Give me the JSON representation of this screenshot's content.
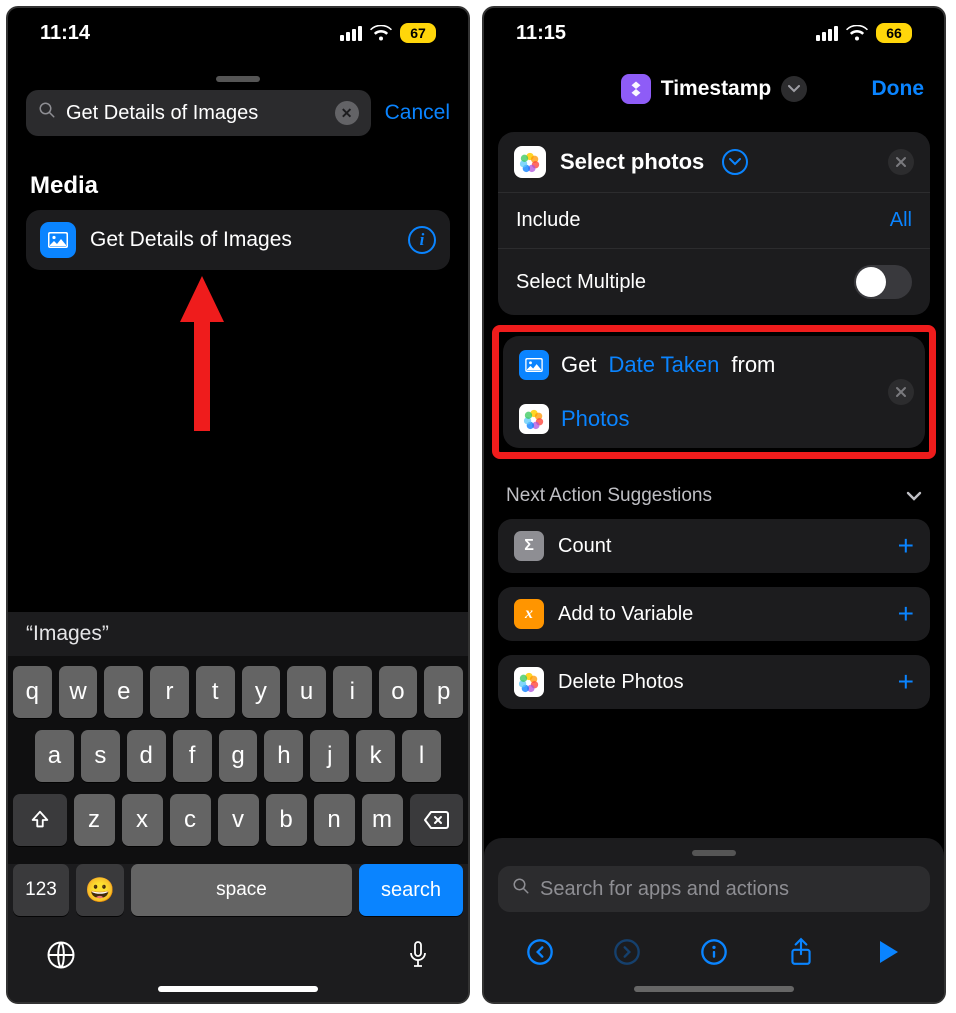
{
  "left": {
    "status": {
      "time": "11:14",
      "battery": "67"
    },
    "search": {
      "query": "Get Details of Images",
      "cancel": "Cancel"
    },
    "section_header": "Media",
    "result": {
      "label": "Get Details of Images"
    },
    "keyboard": {
      "suggestion": "“Images”",
      "row1": [
        "q",
        "w",
        "e",
        "r",
        "t",
        "y",
        "u",
        "i",
        "o",
        "p"
      ],
      "row2": [
        "a",
        "s",
        "d",
        "f",
        "g",
        "h",
        "j",
        "k",
        "l"
      ],
      "row3": [
        "z",
        "x",
        "c",
        "v",
        "b",
        "n",
        "m"
      ],
      "key123": "123",
      "space": "space",
      "search": "search"
    }
  },
  "right": {
    "status": {
      "time": "11:15",
      "battery": "66"
    },
    "header": {
      "title": "Timestamp",
      "done": "Done"
    },
    "select_card": {
      "title": "Select photos",
      "rows": {
        "include_label": "Include",
        "include_value": "All",
        "multiple_label": "Select Multiple"
      }
    },
    "get_card": {
      "prefix": "Get",
      "token1": "Date Taken",
      "mid": "from",
      "token2": "Photos"
    },
    "suggestions": {
      "header": "Next Action Suggestions",
      "items": [
        {
          "label": "Count"
        },
        {
          "label": "Add to Variable"
        },
        {
          "label": "Delete Photos"
        }
      ]
    },
    "search_placeholder": "Search for apps and actions"
  }
}
